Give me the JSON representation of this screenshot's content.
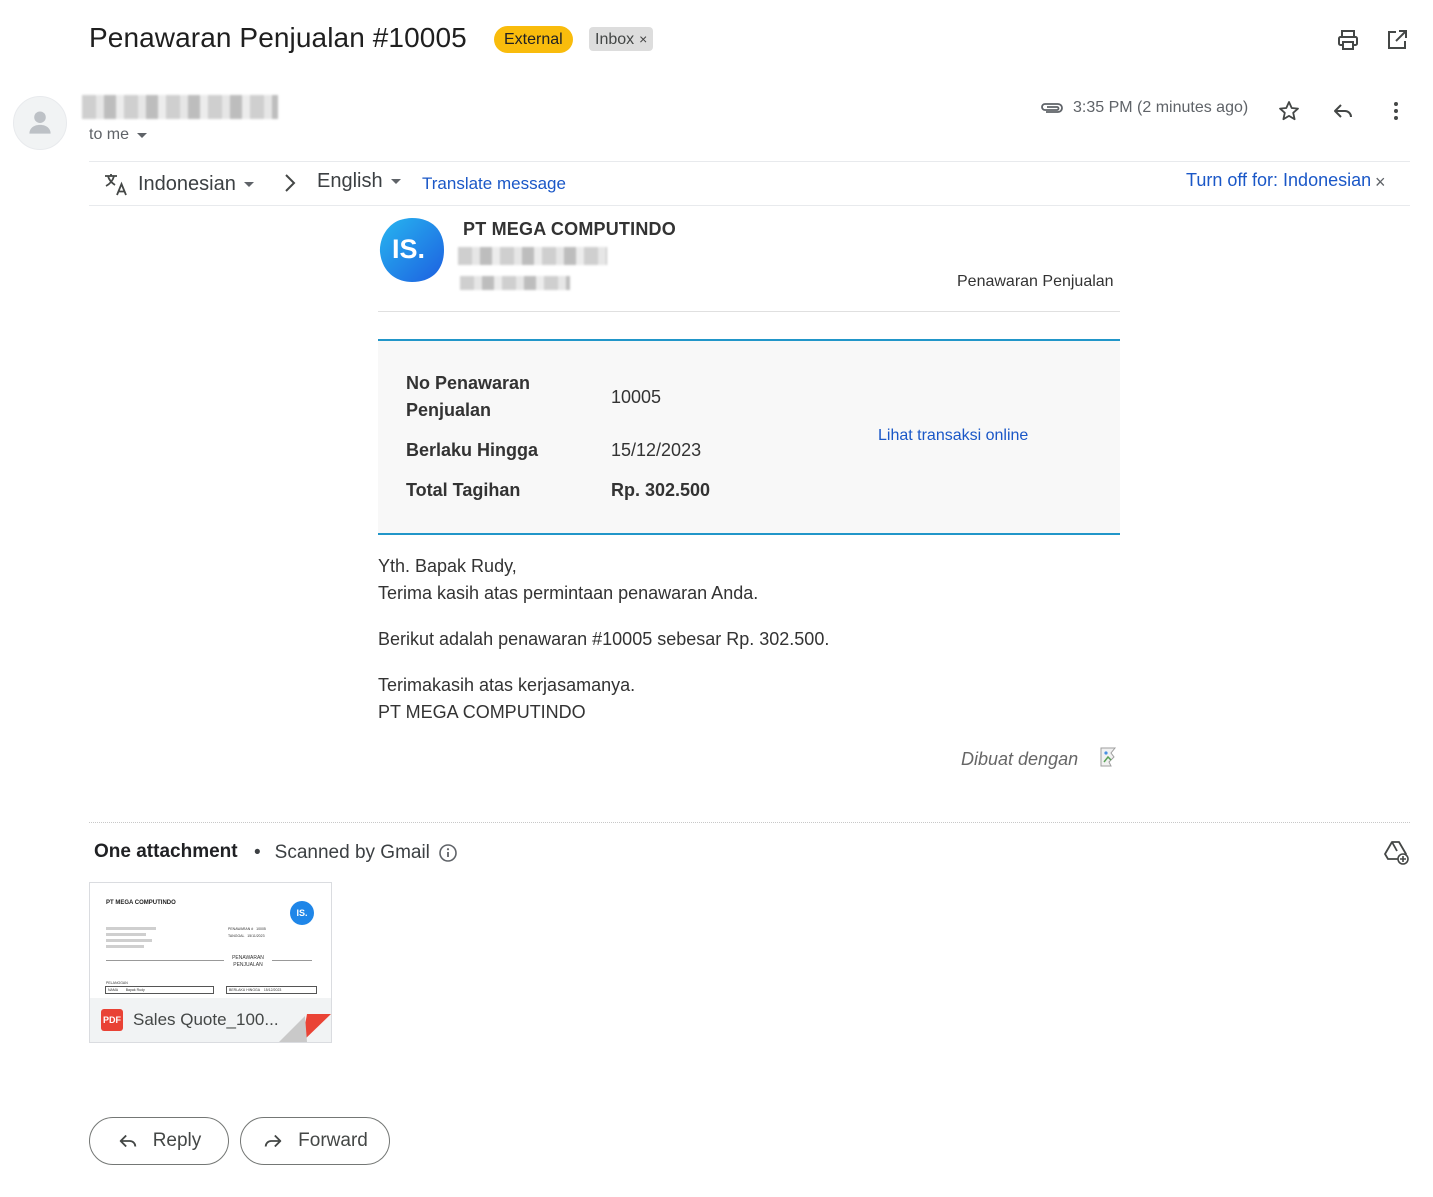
{
  "header": {
    "subject": "Penawaran Penjualan #10005",
    "badge_external": "External",
    "badge_inbox": "Inbox",
    "badge_inbox_close": "×"
  },
  "sender": {
    "to_me": "to me",
    "time": "3:35 PM (2 minutes ago)"
  },
  "translate": {
    "from_lang": "Indonesian",
    "to_lang": "English",
    "translate_link": "Translate message",
    "turn_off": "Turn off for: Indonesian",
    "close": "×"
  },
  "email": {
    "logo_text": "IS.",
    "company": "PT MEGA COMPUTINDO",
    "doc_type": "Penawaran Penjualan",
    "info": {
      "label_no_1": "No Penawaran",
      "label_no_2": "Penjualan",
      "value_no": "10005",
      "label_valid": "Berlaku Hingga",
      "value_valid": "15/12/2023",
      "label_total": "Total Tagihan",
      "value_total": "Rp. 302.500",
      "link": "Lihat transaksi online"
    },
    "greeting": "Yth. Bapak Rudy,",
    "thanks": "Terima kasih atas permintaan penawaran Anda.",
    "offer": "Berikut adalah penawaran #10005 sebesar Rp. 302.500.",
    "closing": "Terimakasih atas kerjasamanya.",
    "signature": "PT MEGA COMPUTINDO",
    "made_with": "Dibuat dengan"
  },
  "attachment": {
    "title": "One attachment",
    "scanned": "Scanned by Gmail",
    "file_name": "Sales Quote_100...",
    "file_type": "PDF",
    "preview": {
      "company": "PT MEGA COMPUTINDO",
      "doc_title_1": "PENAWARAN",
      "doc_title_2": "PENJUALAN",
      "customer": "PELANGGAN",
      "name_label": "NAMA",
      "name_value": "Bapak Rudy",
      "valid_label": "BERLAKU HINGGA",
      "valid_value": "15/12/2023",
      "no_label": "PENAWARAN #",
      "no_value": "10005",
      "date_label": "TANGGAL",
      "date_value": "15/11/2023"
    }
  },
  "actions": {
    "reply": "Reply",
    "forward": "Forward"
  },
  "colors": {
    "external_badge": "#f9bc0c",
    "link": "#1a57c7",
    "accent_line": "#2196c9",
    "pdf_red": "#e94235"
  }
}
